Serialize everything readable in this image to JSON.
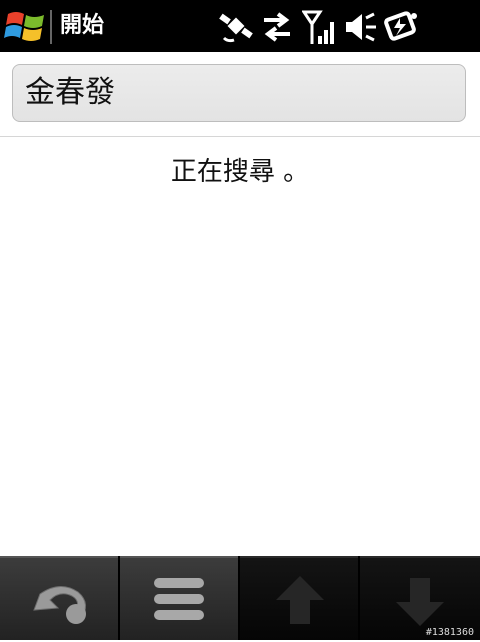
{
  "status_bar": {
    "title": "開始",
    "icons": [
      "windows-start-icon",
      "gps-satellite-icon",
      "data-transfer-icon",
      "signal-strength-icon",
      "speaker-muted-icon",
      "battery-charging-icon"
    ]
  },
  "search": {
    "value": "金春發"
  },
  "status_message": "正在搜尋 。",
  "toolbar": {
    "buttons": [
      "back-icon",
      "menu-icon",
      "scroll-up-icon",
      "scroll-down-icon"
    ]
  },
  "watermark": "#1381360",
  "colors": {
    "bar": "#000000",
    "accent_red": "#e8412b",
    "accent_green": "#7cbb2c",
    "accent_blue": "#2f9be0",
    "accent_yellow": "#f5c02a"
  }
}
